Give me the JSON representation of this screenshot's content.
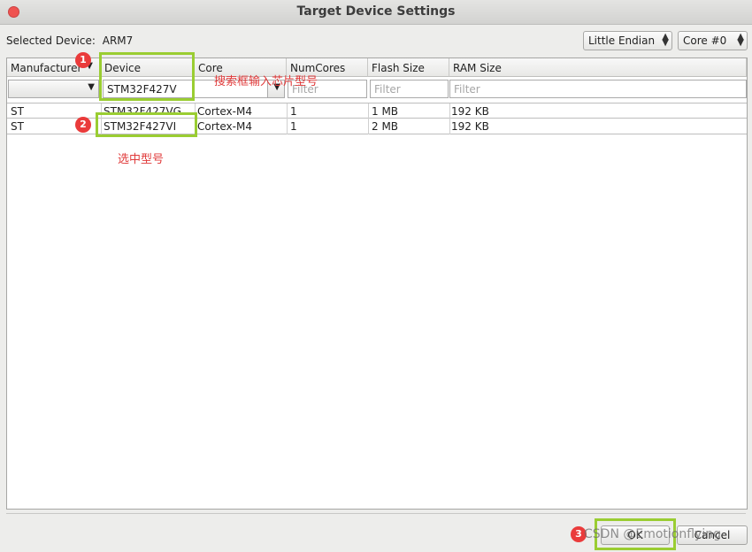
{
  "window": {
    "title": "Target Device Settings"
  },
  "selected_device": {
    "label": "Selected Device:",
    "value": "ARM7"
  },
  "endian_select": {
    "value": "Little Endian"
  },
  "core_select": {
    "value": "Core #0"
  },
  "table": {
    "columns": [
      "Manufacturer",
      "Device",
      "Core",
      "NumCores",
      "Flash Size",
      "RAM Size"
    ],
    "filters": {
      "manufacturer": "",
      "device": "STM32F427V",
      "numcores_placeholder": "Filter",
      "flash_placeholder": "Filter",
      "ram_placeholder": "Filter"
    },
    "rows": [
      {
        "manufacturer": "ST",
        "device": "STM32F427VG",
        "core": "Cortex-M4",
        "numcores": "1",
        "flash": "1 MB",
        "ram": "192 KB"
      },
      {
        "manufacturer": "ST",
        "device": "STM32F427VI",
        "core": "Cortex-M4",
        "numcores": "1",
        "flash": "2 MB",
        "ram": "192 KB"
      }
    ]
  },
  "annotations": {
    "badge1": "1",
    "badge2": "2",
    "badge3": "3",
    "note_search": "搜索框输入芯片型号",
    "note_select": "选中型号",
    "color": "#9acd32"
  },
  "buttons": {
    "ok": "OK",
    "cancel": "Cancel"
  },
  "watermark": "CSDN @Emotionflying"
}
